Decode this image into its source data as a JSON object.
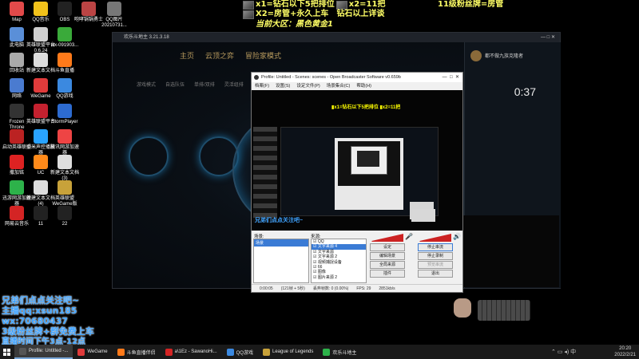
{
  "overlay": {
    "top_line1": "x1=钻石以下5把排位",
    "top_line1b": "x2=11把",
    "top_line2": "X2=房管+永久上车",
    "top_line2b": "钻石以上详谈",
    "top_line3": "当前大区：黑色黄金1",
    "top_right": "11级粉丝牌=房管",
    "bottom_lines": [
      "兄弟们点点关注吧~",
      "主播qq:",
      "wx:",
      "3级粉丝牌+群免费上车",
      "直播时间下午3点-12点"
    ],
    "bottom_qq_value": "xsun185",
    "bottom_wx_value": "70680437",
    "colors": {
      "banner_yellow": "#ffff00",
      "banner_white": "#ffffff",
      "bottom_blue": "#3fa3ff"
    }
  },
  "desktop_icons": [
    {
      "label": "Map",
      "icon": "map-icon",
      "color": "#e24a4a"
    },
    {
      "label": "QQ音乐",
      "icon": "qq-music-icon",
      "color": "#f2c21b"
    },
    {
      "label": "OBS",
      "icon": "obs-icon",
      "color": "#222"
    },
    {
      "label": "咆哮锅锅勇士",
      "icon": "game-icon",
      "color": "#b44"
    },
    {
      "label": "QQ图片20210731...",
      "icon": "image-icon",
      "color": "#777"
    },
    {
      "label": "此电脑",
      "icon": "computer-icon",
      "color": "#5a8fd8"
    },
    {
      "label": "英雄联盟平台 0.6.24",
      "icon": "lol-platform-icon",
      "color": "#cfcfcf"
    },
    {
      "label": "wx-091903...",
      "icon": "wechat-file-icon",
      "color": "#3aaa3a"
    },
    {
      "label": "回收站",
      "icon": "recycle-bin-icon",
      "color": "#aaa"
    },
    {
      "label": "新建文本文档",
      "icon": "text-file-icon",
      "color": "#ddd"
    },
    {
      "label": "斗鱼直播",
      "icon": "douyu-icon",
      "color": "#ff7a1a"
    },
    {
      "label": "网络",
      "icon": "network-icon",
      "color": "#4a7bd0"
    },
    {
      "label": "WeGame",
      "icon": "wegame-icon",
      "color": "#e03b3b"
    },
    {
      "label": "QQ游戏",
      "icon": "qq-game-icon",
      "color": "#3b89e0"
    },
    {
      "label": "Frozen Throne",
      "icon": "frozen-throne-icon",
      "color": "#333"
    },
    {
      "label": "英雄联盟平台",
      "icon": "lol-icon",
      "color": "#c4212f"
    },
    {
      "label": "StormPlayer",
      "icon": "stormplayer-icon",
      "color": "#2d6bd0"
    },
    {
      "label": "启动英雄联盟",
      "icon": "lol-launcher-icon",
      "color": "#b22"
    },
    {
      "label": "小米声控播放器",
      "icon": "player-icon",
      "color": "#29a3ff"
    },
    {
      "label": "腾讯网游加速器",
      "icon": "accelerator-icon",
      "color": "#e44"
    },
    {
      "label": "撒加铭",
      "icon": "game-shortcut-icon",
      "color": "#d22"
    },
    {
      "label": "UC",
      "icon": "uc-icon",
      "color": "#ff8a1a"
    },
    {
      "label": "新建文本文档 (3)",
      "icon": "text-file-icon",
      "color": "#ddd"
    },
    {
      "label": "迅游网游加速器",
      "icon": "xunyou-icon",
      "color": "#2db24a"
    },
    {
      "label": "新建文本文档 (4)",
      "icon": "text-file-icon",
      "color": "#ddd"
    },
    {
      "label": "英雄联盟 WeGame版",
      "icon": "lol-wegame-icon",
      "color": "#c8a23a"
    },
    {
      "label": "网易云音乐",
      "icon": "netease-music-icon",
      "color": "#d42424"
    },
    {
      "label": "11",
      "icon": "folder-icon",
      "color": "#222"
    },
    {
      "label": "22",
      "icon": "folder-icon",
      "color": "#222"
    }
  ],
  "game_window": {
    "title": "欢乐斗地主 3.21.3.18",
    "nav": [
      "主页",
      "云顶之弈",
      "冒险家模式"
    ],
    "sub_nav": [
      "游戏模式",
      "自选队伍",
      "单排/双排",
      "灵活组排"
    ],
    "timer": "0:37",
    "player_name": "都不做九族克隆者"
  },
  "obs": {
    "title": "Profile: Untitled - Scenes: scenes - Open Broadcaster Software v0.659b",
    "menu": [
      "档案(F)",
      "设置(S)",
      "设定文件(P)",
      "场景集合(C)",
      "帮助(H)"
    ],
    "scenes_label": "场景:",
    "sources_label": "来源:",
    "scenes": [
      "场景"
    ],
    "sources": [
      "QQ",
      "文字来源 4",
      "文字来源",
      "文字来源 2",
      "视频捕捉设备",
      "66",
      "图像",
      "图片来源 2"
    ],
    "buttons_left": [
      "设定",
      "编辑场景",
      "全局来源",
      "插件"
    ],
    "buttons_right": [
      "停止串流",
      "停止录制",
      "预览串流",
      "退出"
    ],
    "status": [
      "0:00:05",
      "(121帧 + 5秒)",
      "丢弃帧数: 0 (0.00%)",
      "FPS: 29",
      "2851kb/s"
    ]
  },
  "taskbar": {
    "items": [
      {
        "label": "Profile: Untitled -...",
        "icon": "obs-icon",
        "active": true,
        "color": "#555"
      },
      {
        "label": "WeGame",
        "icon": "wegame-icon",
        "active": false,
        "color": "#e03b3b"
      },
      {
        "label": "斗鱼直播伴侣",
        "icon": "douyu-icon",
        "active": false,
        "color": "#ff7a1a"
      },
      {
        "label": "a\\1Ez - SawanoHi...",
        "icon": "music-icon",
        "active": false,
        "color": "#d42424"
      },
      {
        "label": "QQ游戏",
        "icon": "qq-game-icon",
        "active": false,
        "color": "#3b89e0"
      },
      {
        "label": "League of Legends",
        "icon": "lol-icon",
        "active": false,
        "color": "#c8a23a"
      },
      {
        "label": "欢乐斗地主",
        "icon": "poker-icon",
        "active": false,
        "color": "#2db24a"
      }
    ],
    "time": "20:20",
    "date": "2022/2/21"
  }
}
